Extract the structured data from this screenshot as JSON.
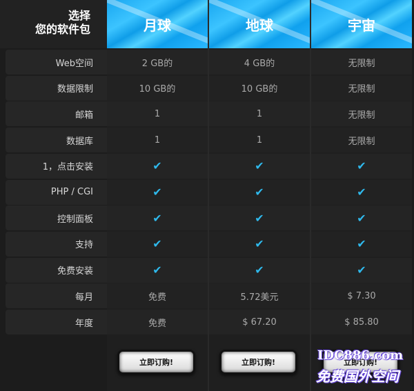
{
  "header": {
    "corner_line1": "选择",
    "corner_line2": "您的软件包",
    "plans": [
      "月球",
      "地球",
      "宇宙"
    ]
  },
  "rows": [
    {
      "label": "Web空间",
      "values": [
        "2 GB的",
        "4 GB的",
        "无限制"
      ]
    },
    {
      "label": "数据限制",
      "values": [
        "10 GB的",
        "10 GB的",
        "无限制"
      ]
    },
    {
      "label": "邮箱",
      "values": [
        "1",
        "1",
        "无限制"
      ]
    },
    {
      "label": "数据库",
      "values": [
        "1",
        "1",
        "无限制"
      ]
    },
    {
      "label": "1，点击安装",
      "values": [
        "✔",
        "✔",
        "✔"
      ]
    },
    {
      "label": "PHP / CGI",
      "values": [
        "✔",
        "✔",
        "✔"
      ]
    },
    {
      "label": "控制面板",
      "values": [
        "✔",
        "✔",
        "✔"
      ]
    },
    {
      "label": "支持",
      "values": [
        "✔",
        "✔",
        "✔"
      ]
    },
    {
      "label": "免费安装",
      "values": [
        "✔",
        "✔",
        "✔"
      ]
    },
    {
      "label": "每月",
      "values": [
        "免费",
        "5.72美元",
        "$ 7.30"
      ]
    },
    {
      "label": "年度",
      "values": [
        "免费",
        "$ 67.20",
        "$ 85.80"
      ]
    }
  ],
  "buttons": [
    "立即订购!",
    "立即订购!",
    "立即订购!"
  ],
  "watermark": {
    "line1": "IDC886.com",
    "line2": "免费国外空间"
  },
  "colors": {
    "accent": "#2fb9ec",
    "header_blue": "#18a6f0"
  }
}
